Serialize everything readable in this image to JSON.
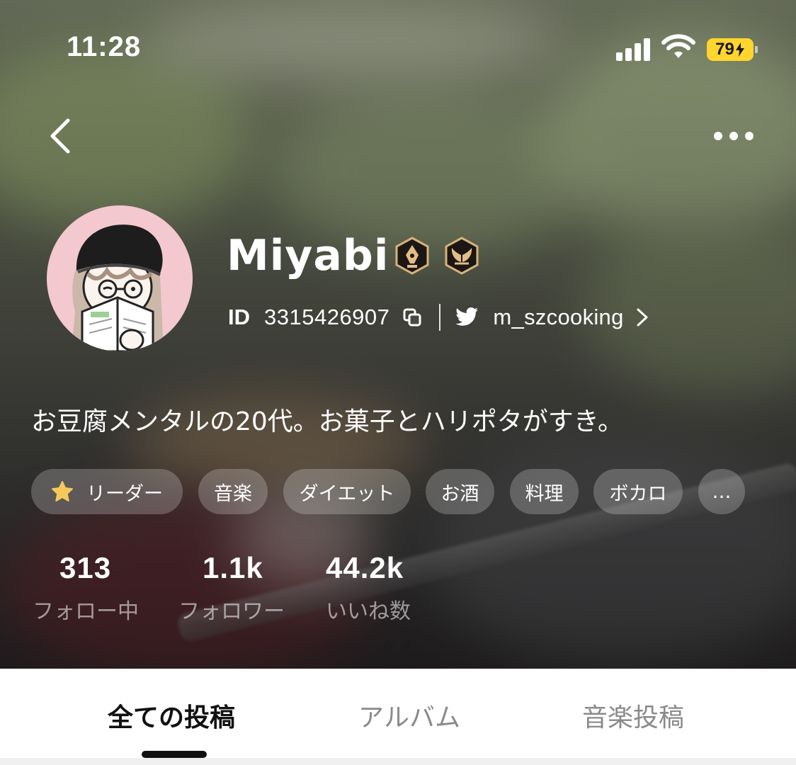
{
  "status_bar": {
    "time": "11:28",
    "battery": "79"
  },
  "nav": {
    "back_icon": "chevron-left-icon",
    "more_icon": "ellipsis-icon"
  },
  "profile": {
    "username": "Miyabi",
    "badges": [
      "pen-nib-badge-icon",
      "wings-badge-icon"
    ],
    "id_label": "ID",
    "id_value": "3315426907",
    "twitter_handle": "m_szcooking",
    "bio": "お豆腐メンタルの20代。お菓子とハリポタがすき。"
  },
  "tags": [
    {
      "label": "リーダー",
      "icon": "star-icon"
    },
    {
      "label": "音楽"
    },
    {
      "label": "ダイエット"
    },
    {
      "label": "お酒"
    },
    {
      "label": "料理"
    },
    {
      "label": "ボカロ"
    },
    {
      "label": "…"
    }
  ],
  "stats": [
    {
      "value": "313",
      "label": "フォロー中"
    },
    {
      "value": "1.1k",
      "label": "フォロワー"
    },
    {
      "value": "44.2k",
      "label": "いいね数"
    }
  ],
  "tabs": [
    {
      "label": "全ての投稿",
      "active": true
    },
    {
      "label": "アルバム",
      "active": false
    },
    {
      "label": "音楽投稿",
      "active": false
    }
  ],
  "colors": {
    "battery": "#ffd52e",
    "badge_gold": "#d9b27a",
    "avatar_bg": "#f3c8cf",
    "star": "#f6c85a"
  }
}
